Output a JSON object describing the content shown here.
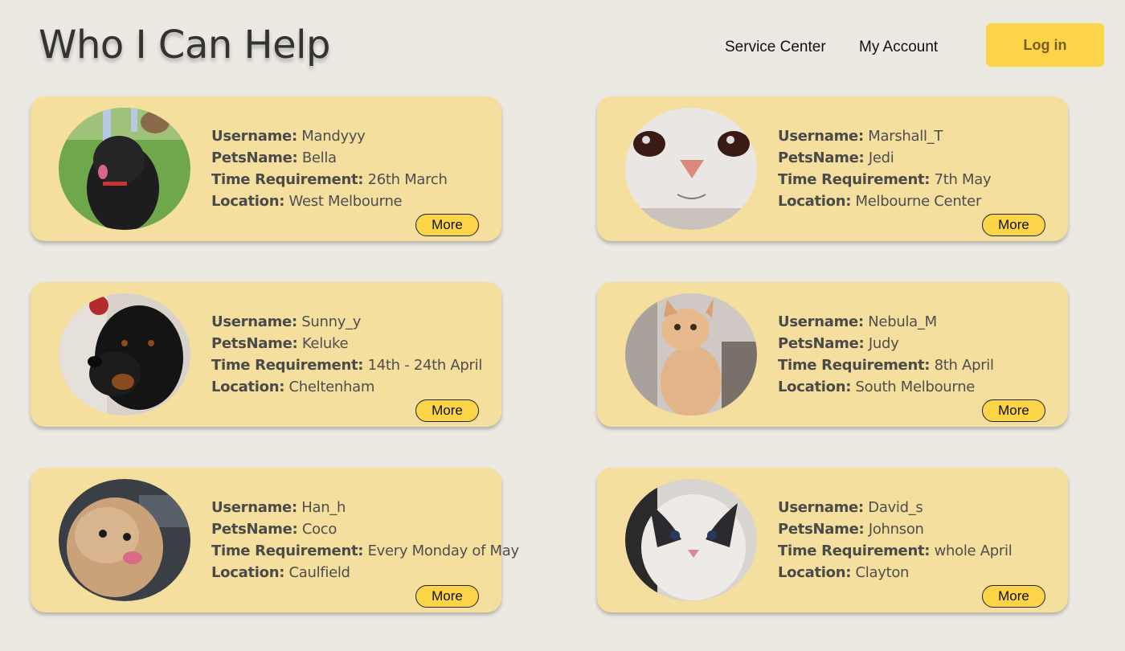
{
  "header": {
    "title": "Who I Can Help",
    "nav": [
      "Service Center",
      "My Account"
    ],
    "login_label": "Log in"
  },
  "labels": {
    "username": "Username:",
    "petsname": "PetsName:",
    "time": "Time Requirement:",
    "location": "Location:",
    "more": "More"
  },
  "cards": [
    {
      "username": "Mandyyy",
      "petsname": "Bella",
      "time": "26th March",
      "location": "West Melbourne",
      "pet_image": "black-poodle-photo"
    },
    {
      "username": "Marshall_T",
      "petsname": "Jedi",
      "time": "7th May",
      "location": "Melbourne Center",
      "pet_image": "white-cat-closeup-photo"
    },
    {
      "username": "Sunny_y",
      "petsname": "Keluke",
      "time": "14th - 24th April",
      "location": "Cheltenham",
      "pet_image": "rottweiler-photo"
    },
    {
      "username": "Nebula_M",
      "petsname": "Judy",
      "time": "8th April",
      "location": "South Melbourne",
      "pet_image": "orange-cat-photo"
    },
    {
      "username": "Han_h",
      "petsname": "Coco",
      "time": "Every Monday of May",
      "location": "Caulfield",
      "pet_image": "apricot-poodle-photo"
    },
    {
      "username": "David_s",
      "petsname": "Johnson",
      "time": "whole April",
      "location": "Clayton",
      "pet_image": "ragdoll-cat-photo"
    }
  ],
  "colors": {
    "background": "#ece9e2",
    "card": "#f5df9e",
    "accent": "#fbd448"
  }
}
